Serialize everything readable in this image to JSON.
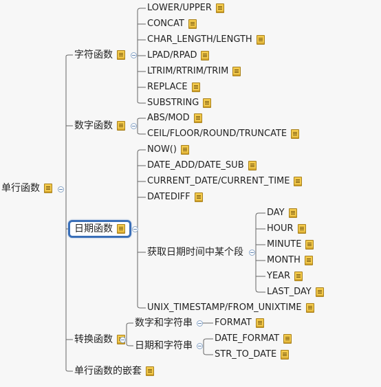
{
  "root": "单行函数",
  "cat_string": "字符函数",
  "cat_number": "数字函数",
  "cat_date": "日期函数",
  "cat_convert": "转换函数",
  "cat_nested": "单行函数的嵌套",
  "string_funcs": [
    "LOWER/UPPER",
    "CONCAT",
    "CHAR_LENGTH/LENGTH",
    "LPAD/RPAD",
    "LTRIM/RTRIM/TRIM",
    "REPLACE",
    "SUBSTRING"
  ],
  "number_funcs": [
    "ABS/MOD",
    "CEIL/FLOOR/ROUND/TRUNCATE"
  ],
  "date_funcs": [
    "NOW()",
    "DATE_ADD/DATE_SUB",
    "CURRENT_DATE/CURRENT_TIME",
    "DATEDIFF"
  ],
  "date_part_label": "获取日期时间中某个段",
  "date_parts": [
    "DAY",
    "HOUR",
    "MINUTE",
    "MONTH",
    "YEAR",
    "LAST_DAY"
  ],
  "date_last": "UNIX_TIMESTAMP/FROM_UNIXTIME",
  "convert_num_str": "数字和字符串",
  "convert_format": "FORMAT",
  "convert_date_str": "日期和字符串",
  "convert_date_funcs": [
    "DATE_FORMAT",
    "STR_TO_DATE"
  ]
}
